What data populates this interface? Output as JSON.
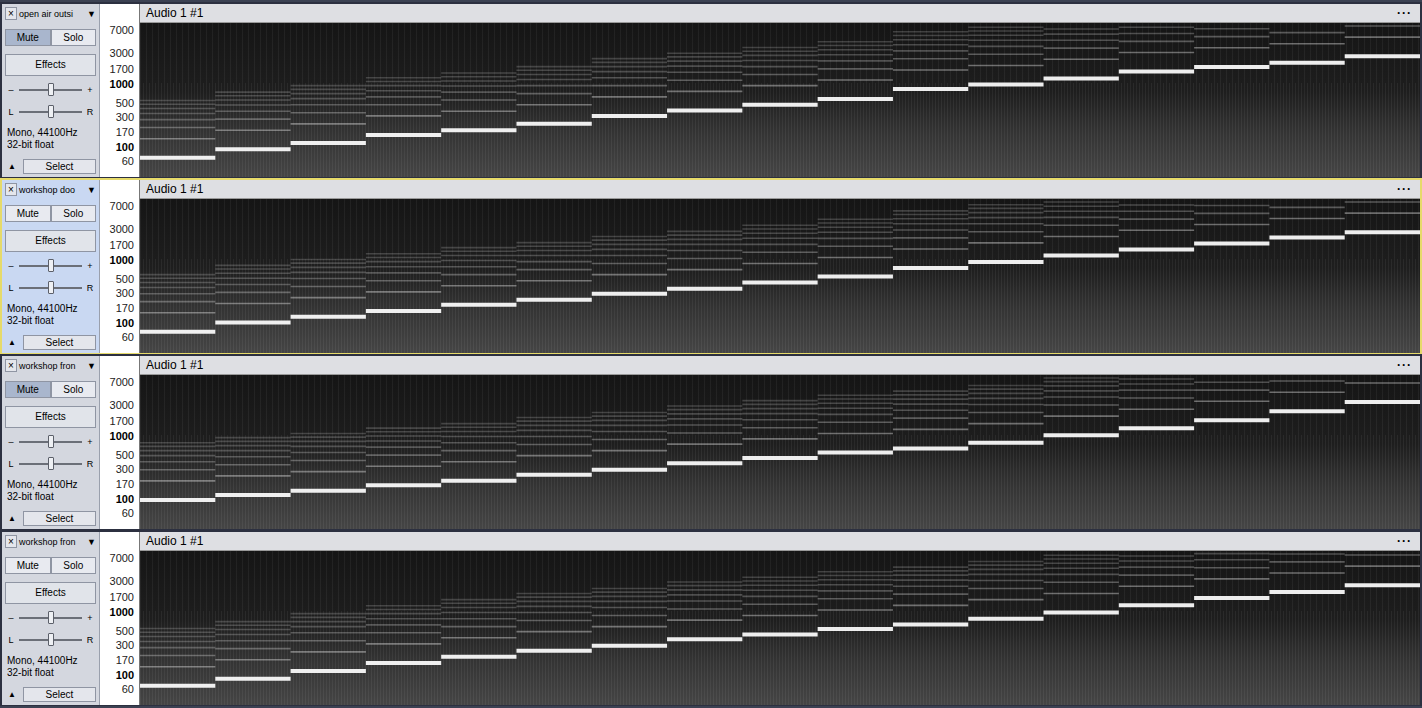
{
  "tracks": [
    {
      "name": "open air outsi",
      "close": "×",
      "menu_icon": "▼",
      "clip_title": "Audio 1 #1",
      "clip_menu": "···",
      "mute": "Mute",
      "solo": "Solo",
      "muted": true,
      "soloed": false,
      "selected": false,
      "effects": "Effects",
      "gain_minus": "–",
      "gain_plus": "+",
      "gain": 0.5,
      "pan_left": "L",
      "pan_right": "R",
      "pan": 0.5,
      "info": [
        "Mono, 44100Hz",
        "32-bit float"
      ],
      "collapse": "▲",
      "select": "Select",
      "notes": [
        70,
        95,
        120,
        160,
        190,
        240,
        320,
        390,
        480,
        590,
        850,
        1000,
        1250,
        1600,
        1900,
        2200,
        2800
      ]
    },
    {
      "name": "workshop doo",
      "close": "×",
      "menu_icon": "▼",
      "clip_title": "Audio 1 #1",
      "clip_menu": "···",
      "mute": "Mute",
      "solo": "Solo",
      "muted": false,
      "soloed": false,
      "selected": true,
      "effects": "Effects",
      "gain_minus": "–",
      "gain_plus": "+",
      "gain": 0.5,
      "pan_left": "L",
      "pan_right": "R",
      "pan": 0.5,
      "info": [
        "Mono, 44100Hz",
        "32-bit float"
      ],
      "collapse": "▲",
      "select": "Select",
      "notes": [
        75,
        105,
        130,
        160,
        200,
        240,
        300,
        360,
        450,
        560,
        760,
        950,
        1200,
        1500,
        1850,
        2300,
        2800
      ]
    },
    {
      "name": "workshop fron",
      "close": "×",
      "menu_icon": "▼",
      "clip_title": "Audio 1 #1",
      "clip_menu": "···",
      "mute": "Mute",
      "solo": "Solo",
      "muted": true,
      "soloed": false,
      "selected": false,
      "effects": "Effects",
      "gain_minus": "–",
      "gain_plus": "+",
      "gain": 0.5,
      "pan_left": "L",
      "pan_right": "R",
      "pan": 0.5,
      "info": [
        "Mono, 44100Hz",
        "32-bit float"
      ],
      "collapse": "▲",
      "select": "Select",
      "notes": [
        100,
        120,
        140,
        170,
        200,
        250,
        300,
        380,
        460,
        560,
        650,
        800,
        1050,
        1350,
        1800,
        2500,
        3500
      ]
    },
    {
      "name": "workshop fron",
      "close": "×",
      "menu_icon": "▼",
      "clip_title": "Audio 1 #1",
      "clip_menu": "···",
      "mute": "Mute",
      "solo": "Solo",
      "muted": false,
      "soloed": false,
      "selected": false,
      "effects": "Effects",
      "gain_minus": "–",
      "gain_plus": "+",
      "gain": 0.5,
      "pan_left": "L",
      "pan_right": "R",
      "pan": 0.5,
      "info": [
        "Mono, 44100Hz",
        "32-bit float"
      ],
      "collapse": "▲",
      "select": "Select",
      "notes": [
        70,
        90,
        120,
        160,
        200,
        250,
        300,
        380,
        450,
        550,
        650,
        800,
        1000,
        1300,
        1700,
        2100,
        2700
      ]
    }
  ],
  "ruler_labels": [
    {
      "label": "7000",
      "bold": false
    },
    {
      "label": "3000",
      "bold": false
    },
    {
      "label": "1700",
      "bold": false
    },
    {
      "label": "1000",
      "bold": true
    },
    {
      "label": "500",
      "bold": false
    },
    {
      "label": "300",
      "bold": false
    },
    {
      "label": "170",
      "bold": false
    },
    {
      "label": "100",
      "bold": true
    },
    {
      "label": "60",
      "bold": false
    }
  ]
}
